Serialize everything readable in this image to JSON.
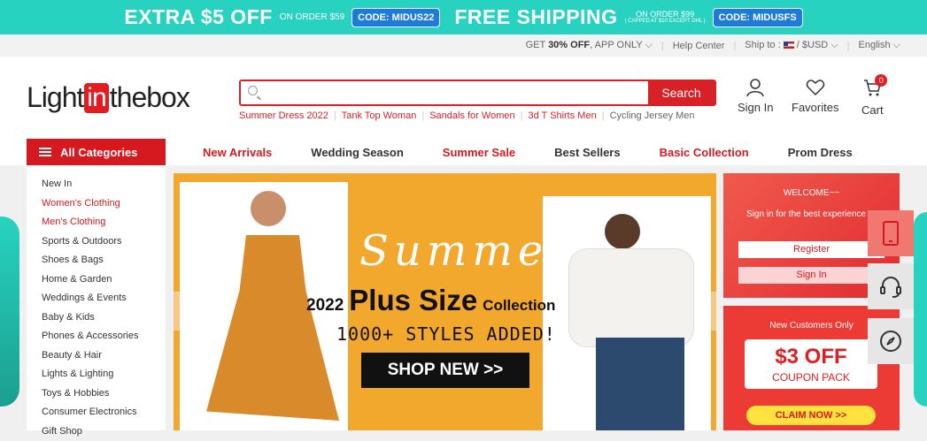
{
  "promo": {
    "extra": "EXTRA $5 OFF",
    "extra_sub": "ON ORDER $59",
    "code1": "CODE: MIDUS22",
    "free": "FREE SHIPPING",
    "free_sub1": "ON ORDER $99",
    "free_sub2": "( CAPPED AT $10 EXCEPT DHL )",
    "code2": "CODE: MIDUSFS"
  },
  "util": {
    "app_pre": "GET ",
    "app_bold": "30% OFF",
    "app_post": ", APP ONLY",
    "help": "Help Center",
    "ship": "Ship to :",
    "currency": "/ $USD",
    "lang": "English"
  },
  "header": {
    "logo_left": "Light",
    "logo_mid": "in",
    "logo_right": "thebox",
    "search_placeholder": "",
    "search_button": "Search",
    "hot_searches": [
      "Summer Dress 2022",
      "Tank Top Woman",
      "Sandals for Women",
      "3d T Shirts Men",
      "Cycling Jersey Men"
    ],
    "sign_in": "Sign In",
    "favorites": "Favorites",
    "cart": "Cart",
    "cart_count": "0"
  },
  "nav": {
    "all_categories": "All Categories",
    "links": [
      "New Arrivals",
      "Wedding Season",
      "Summer Sale",
      "Best Sellers",
      "Basic Collection",
      "Prom Dress"
    ]
  },
  "sidebar": {
    "items": [
      "New In",
      "Women's Clothing",
      "Men's Clothing",
      "Sports & Outdoors",
      "Shoes & Bags",
      "Home & Garden",
      "Weddings & Events",
      "Baby & Kids",
      "Phones & Accessories",
      "Beauty & Hair",
      "Lights & Lighting",
      "Toys & Hobbies",
      "Consumer Electronics",
      "Gift Shop"
    ]
  },
  "banner": {
    "script": "Summer",
    "year": "2022",
    "headline": "Plus Size",
    "collection": "Collection",
    "styles": "1000+ STYLES ADDED!",
    "cta": "SHOP NEW >>"
  },
  "welcome": {
    "title": "WELCOME~~",
    "subtitle": "Sign in for the best experience",
    "register": "Register",
    "sign_in": "Sign In"
  },
  "coupon": {
    "title": "New Customers Only",
    "amount": "$3 OFF",
    "pack": "COUPON PACK",
    "claim": "CLAIM NOW >>"
  }
}
